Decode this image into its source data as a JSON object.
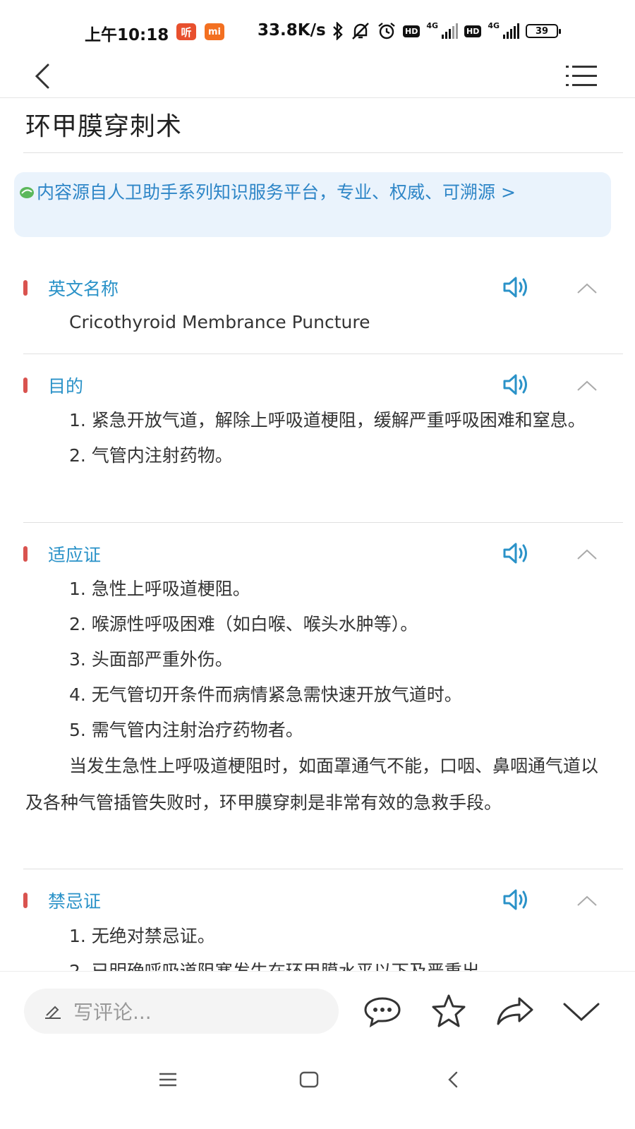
{
  "status_bar": {
    "time": "上午10:18",
    "app_badge_1": "听",
    "app_badge_2": "mi",
    "net_speed": "33.8K/s",
    "hd_1": "HD",
    "net_type_1": "4G",
    "hd_2": "HD",
    "net_type_2": "4G",
    "battery": "39"
  },
  "article": {
    "title": "环甲膜穿刺术",
    "source_banner": "内容源自人卫助手系列知识服务平台，专业、权威、可溯源 >"
  },
  "sections": [
    {
      "title": "英文名称",
      "paragraphs": [
        "Cricothyroid Membrance Puncture"
      ]
    },
    {
      "title": "目的",
      "paragraphs": [
        "1. 紧急开放气道，解除上呼吸道梗阻，缓解严重呼吸困难和窒息。",
        "2. 气管内注射药物。"
      ]
    },
    {
      "title": "适应证",
      "paragraphs": [
        "1. 急性上呼吸道梗阻。",
        "2. 喉源性呼吸困难（如白喉、喉头水肿等）。",
        "3. 头面部严重外伤。",
        "4. 无气管切开条件而病情紧急需快速开放气道时。",
        "5. 需气管内注射治疗药物者。",
        "当发生急性上呼吸道梗阻时，如面罩通气不能，口咽、鼻咽通气道以及各种气管插管失败时，环甲膜穿刺是非常有效的急救手段。"
      ]
    },
    {
      "title": "禁忌证",
      "paragraphs": [
        "1. 无绝对禁忌证。",
        "2. 已明确呼吸道阻塞发生在环甲膜水平以下及严重出"
      ]
    }
  ],
  "comment_bar": {
    "placeholder": "写评论..."
  },
  "icons": {
    "back": "chevron-left-icon",
    "menu": "list-menu-icon",
    "speaker": "speaker-icon",
    "collapse": "chevron-up-icon",
    "comment": "comment-bubble-icon",
    "favorite": "star-icon",
    "share": "share-arrow-icon",
    "more": "chevron-down-icon"
  },
  "colors": {
    "accent": "#2a92c8",
    "marker": "#d9534f",
    "banner_bg": "#eaf3fc",
    "banner_text": "#2e86c7"
  }
}
